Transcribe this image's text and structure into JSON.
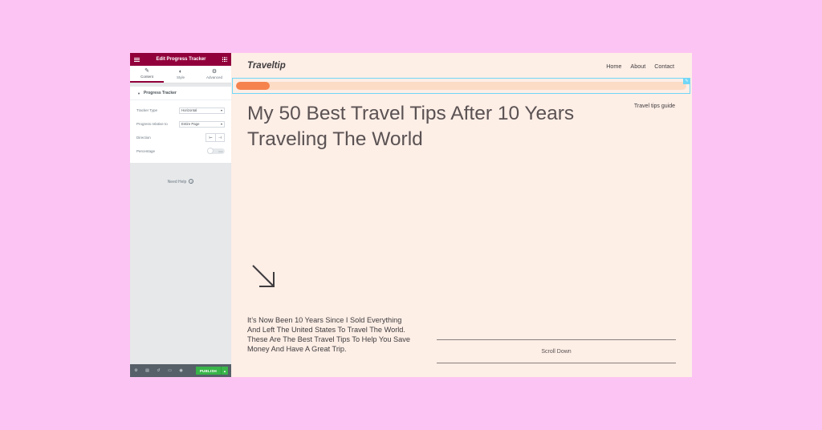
{
  "editor": {
    "title": "Edit Progress Tracker",
    "tabs": [
      {
        "label": "Content",
        "icon": "pencil-icon"
      },
      {
        "label": "Style",
        "icon": "contrast-icon"
      },
      {
        "label": "Advanced",
        "icon": "gear-icon"
      }
    ],
    "section_title": "Progress Tracker",
    "controls": {
      "tracker_type_label": "Tracker Type",
      "tracker_type_value": "Horizontal",
      "progress_relative_label": "Progress relative to",
      "progress_relative_value": "Entire Page",
      "direction_label": "Direction",
      "percentage_label": "Percentage",
      "percentage_toggle": "Hide"
    },
    "need_help": "Need Help",
    "publish_label": "PUBLISH"
  },
  "site": {
    "logo": "Traveltip",
    "nav": [
      "Home",
      "About",
      "Contact"
    ],
    "progress_fraction": 0.075,
    "hero_title": "My 50 Best Travel Tips After 10 Years Traveling The World",
    "guide_label": "Travel tips guide",
    "description": "It’s Now Been 10 Years Since I Sold Everything And Left The United States To Travel The World. These Are The Best Travel Tips To Help You Save Money And Have A Great Trip.",
    "scroll_label": "Scroll Down"
  },
  "colors": {
    "editor_header": "#92003b",
    "publish": "#39b54a",
    "tracker_fill": "#f5834e",
    "tracker_track": "#fcdcc5",
    "preview_bg": "#fdeee6",
    "page_bg": "#fcc4f2"
  }
}
